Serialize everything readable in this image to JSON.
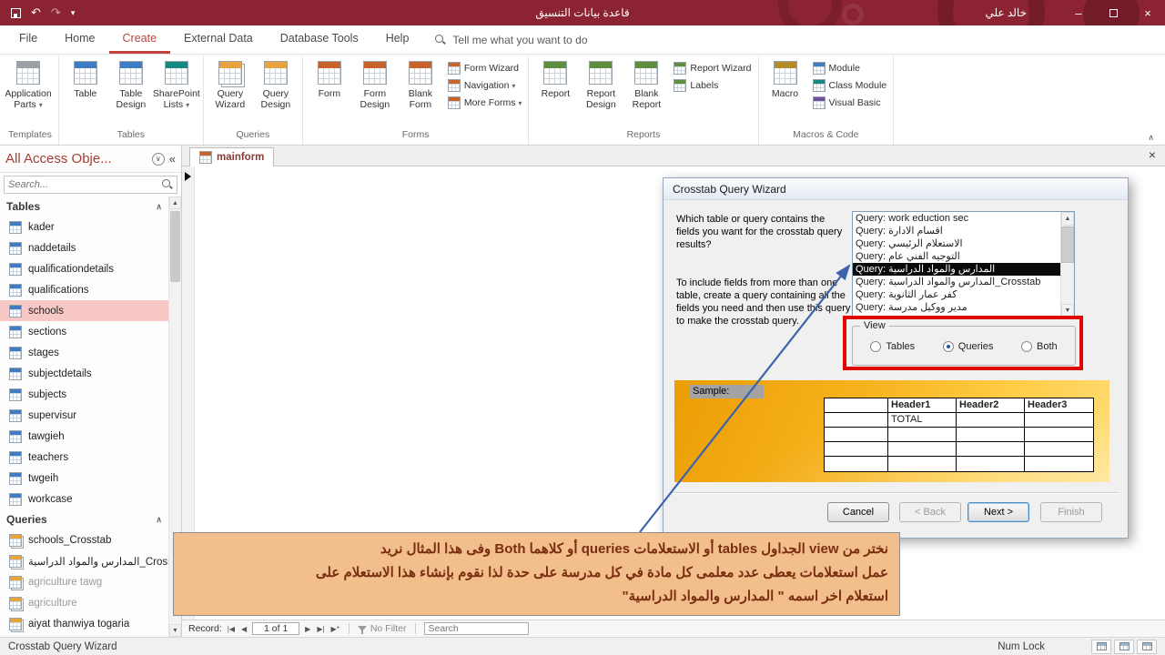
{
  "icons": {
    "undo": "↶",
    "redo": "↷",
    "dropdown": "▾",
    "minimize": "–",
    "close": "×",
    "shutter": "«",
    "nav_menu": "∨",
    "section_collapse": "∧",
    "ribbon_collapse": "∧",
    "scroll_up": "▲",
    "scroll_down": "▼",
    "rec_first": "|◀",
    "rec_prev": "◀",
    "rec_next": "▶",
    "rec_last": "▶|",
    "rec_new": "▶*"
  },
  "titlebar": {
    "title": "قاعدة بيانات التنسيق",
    "user": "خالد علي"
  },
  "ribbon": {
    "tabs": [
      {
        "label": "File"
      },
      {
        "label": "Home"
      },
      {
        "label": "Create",
        "active": true
      },
      {
        "label": "External Data"
      },
      {
        "label": "Database Tools"
      },
      {
        "label": "Help"
      }
    ],
    "tell_me": "Tell me what you want to do",
    "groups": [
      {
        "name": "Templates",
        "buttons": [
          {
            "label": "Application Parts",
            "icon": "appparts",
            "caret": true
          }
        ]
      },
      {
        "name": "Tables",
        "buttons": [
          {
            "label": "Table",
            "icon": "table"
          },
          {
            "label": "Table Design",
            "icon": "tabledesign"
          },
          {
            "label": "SharePoint Lists",
            "icon": "sharepoint",
            "caret": true
          }
        ]
      },
      {
        "name": "Queries",
        "buttons": [
          {
            "label": "Query Wizard",
            "icon": "querywizard"
          },
          {
            "label": "Query Design",
            "icon": "querydesign"
          }
        ]
      },
      {
        "name": "Forms",
        "buttons": [
          {
            "label": "Form",
            "icon": "form"
          },
          {
            "label": "Form Design",
            "icon": "formdesign"
          },
          {
            "label": "Blank Form",
            "icon": "blankform"
          },
          {
            "label": "Form Wizard",
            "icon": "formwizard",
            "small": true
          },
          {
            "label": "Navigation",
            "icon": "navigation",
            "small": true,
            "caret": true
          },
          {
            "label": "More Forms",
            "icon": "moreforms",
            "small": true,
            "caret": true
          }
        ]
      },
      {
        "name": "Reports",
        "buttons": [
          {
            "label": "Report",
            "icon": "report"
          },
          {
            "label": "Report Design",
            "icon": "reportdesign"
          },
          {
            "label": "Blank Report",
            "icon": "blankreport"
          },
          {
            "label": "Report Wizard",
            "icon": "reportwizard",
            "small": true
          },
          {
            "label": "Labels",
            "icon": "labels",
            "small": true
          }
        ]
      },
      {
        "name": "Macros & Code",
        "buttons": [
          {
            "label": "Macro",
            "icon": "macro"
          },
          {
            "label": "Module",
            "icon": "module",
            "small": true
          },
          {
            "label": "Class Module",
            "icon": "classmodule",
            "small": true
          },
          {
            "label": "Visual Basic",
            "icon": "vb",
            "small": true
          }
        ]
      }
    ]
  },
  "nav_pane": {
    "title": "All Access Obje...",
    "search_placeholder": "Search...",
    "sections": [
      {
        "name": "Tables",
        "kind": "tables",
        "items": [
          {
            "label": "kader"
          },
          {
            "label": "naddetails"
          },
          {
            "label": "qualificationdetails"
          },
          {
            "label": "qualifications"
          },
          {
            "label": "schools",
            "selected": true
          },
          {
            "label": "sections"
          },
          {
            "label": "stages"
          },
          {
            "label": "subjectdetails"
          },
          {
            "label": "subjects"
          },
          {
            "label": "supervisur"
          },
          {
            "label": "tawgieh"
          },
          {
            "label": "teachers"
          },
          {
            "label": "twgeih"
          },
          {
            "label": "workcase"
          }
        ]
      },
      {
        "name": "Queries",
        "kind": "queries",
        "items": [
          {
            "label": "schools_Crosstab"
          },
          {
            "label": "المدارس والمواد الدراسية_Crosst..."
          },
          {
            "label": "agriculture tawg",
            "muted": true
          },
          {
            "label": "agriculture",
            "muted": true
          },
          {
            "label": "aiyat thanwiya togaria"
          }
        ]
      }
    ]
  },
  "document": {
    "tab": "mainform"
  },
  "dialog": {
    "title": "Crosstab Query Wizard",
    "prompt1": "Which table or query contains the fields you want for the crosstab query results?",
    "prompt2": "To include fields from more than one table, create a query containing all the fields you need and then use this query to make the crosstab query.",
    "list_items": [
      "Query: work eduction sec",
      "Query: اقسام الادارة",
      "Query: الاستعلام الرئيسي",
      "Query: التوجيه الفني عام",
      "Query: المدارس والمواد الدراسية",
      "Query: المدارس والمواد الدراسية_Crosstab",
      "Query: كفر عمار الثانوية",
      "Query: مدير ووكيل مدرسة"
    ],
    "selected_index": 4,
    "view_group": {
      "label": "View",
      "options": [
        "Tables",
        "Queries",
        "Both"
      ],
      "selected": "Queries"
    },
    "sample_label": "Sample:",
    "sample_table": {
      "headers": [
        "Header1",
        "Header2",
        "Header3"
      ],
      "row_label": "TOTAL"
    },
    "buttons": [
      "Cancel",
      "< Back",
      "Next >",
      "Finish"
    ]
  },
  "annotation": {
    "lines": [
      "نختر من view الجداول tables أو الاستعلامات queries أو كلاهما Both وفى هذا المثال نريد",
      "عمل استعلامات يعطى عدد معلمى كل مادة في كل مدرسة على حدة لذا نقوم بإنشاء هذا الاستعلام على",
      "استعلام اخر اسمه \" المدارس والمواد الدراسية\""
    ]
  },
  "record_bar": {
    "label": "Record:",
    "position": "1 of 1",
    "filter": "No Filter",
    "search_placeholder": "Search"
  },
  "status_bar": {
    "left": "Crosstab Query Wizard",
    "right": "Num Lock"
  }
}
